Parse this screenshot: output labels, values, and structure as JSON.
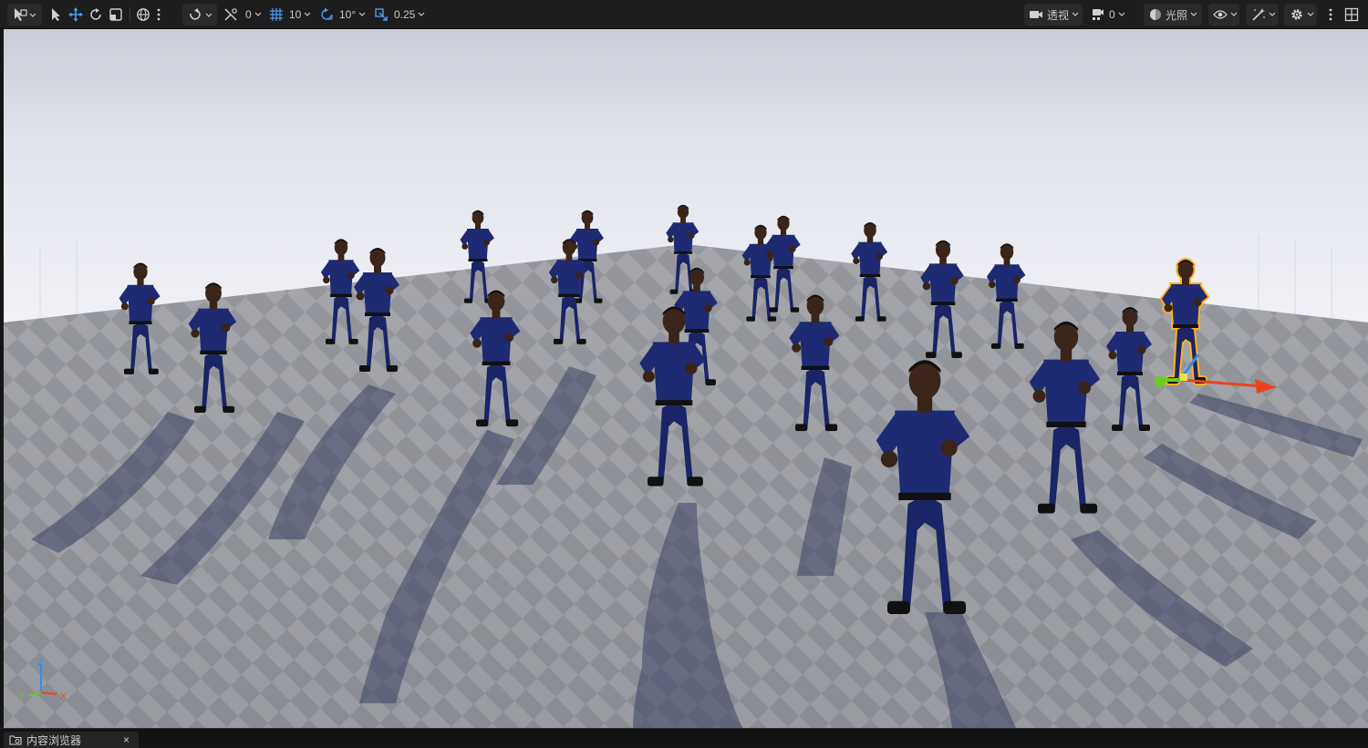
{
  "toolbar": {
    "rotation_snap_value": "0",
    "grid_snap_value": "10",
    "angle_snap_value": "10°",
    "scale_snap_value": "0.25",
    "view_mode_label": "透视",
    "camera_speed_value": "0",
    "lighting_mode_label": "光照"
  },
  "bottom": {
    "tab_label": "内容浏览器",
    "close_glyph": "×"
  },
  "axis_gizmo": {
    "z_label": "Z",
    "y_label": "Y",
    "x_label": "X"
  },
  "colors": {
    "toolbar_bg": "#1d1d1d",
    "selection_outline": "#ffb020",
    "gizmo_x": "#e8451f",
    "gizmo_y": "#6ccc1e",
    "gizmo_z": "#2f8fe8",
    "character_shirt": "#1e2a72",
    "floor_light": "#9ea0a6",
    "floor_dark": "#7c7e85"
  }
}
